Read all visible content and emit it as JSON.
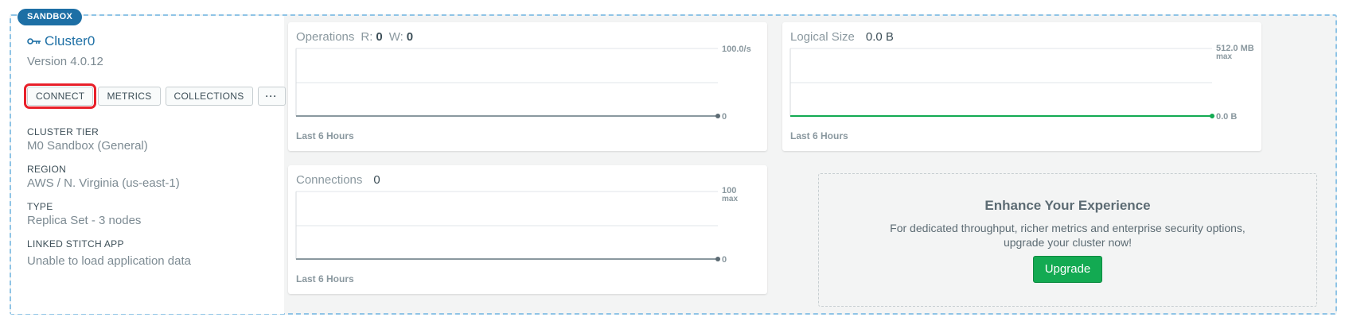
{
  "tag": "SANDBOX",
  "cluster": {
    "name": "Cluster0",
    "version": "Version 4.0.12",
    "buttons": {
      "connect": "CONNECT",
      "metrics": "METRICS",
      "collections": "COLLECTIONS",
      "more": "···"
    },
    "info": [
      {
        "label": "CLUSTER TIER",
        "value": "M0 Sandbox (General)"
      },
      {
        "label": "REGION",
        "value": "AWS / N. Virginia (us-east-1)"
      },
      {
        "label": "TYPE",
        "value": "Replica Set - 3 nodes"
      },
      {
        "label": "LINKED STITCH APP",
        "value": "Unable to load application data"
      }
    ]
  },
  "operations": {
    "title": "Operations",
    "r_label": "R:",
    "r_value": "0",
    "w_label": "W:",
    "w_value": "0",
    "max_label": "100.0/s",
    "min_label": "0",
    "footer": "Last 6 Hours",
    "line_color": "#5c6b73"
  },
  "logical_size": {
    "title": "Logical Size",
    "value": "0.0 B",
    "max_label": "512.0 MB",
    "max_sub": "max",
    "min_label": "0.0 B",
    "footer": "Last 6 Hours",
    "line_color": "#13aa52"
  },
  "connections": {
    "title": "Connections",
    "value": "0",
    "max_label": "100",
    "max_sub": "max",
    "min_label": "0",
    "footer": "Last 6 Hours",
    "line_color": "#5c6b73"
  },
  "promo": {
    "title": "Enhance Your Experience",
    "line1": "For dedicated throughput, richer metrics and enterprise security options,",
    "line2": "upgrade your cluster now!",
    "button": "Upgrade"
  },
  "colors": {
    "brand_blue": "#1d6fa5",
    "highlight_red": "#e8202a",
    "upgrade_green": "#13aa52"
  }
}
